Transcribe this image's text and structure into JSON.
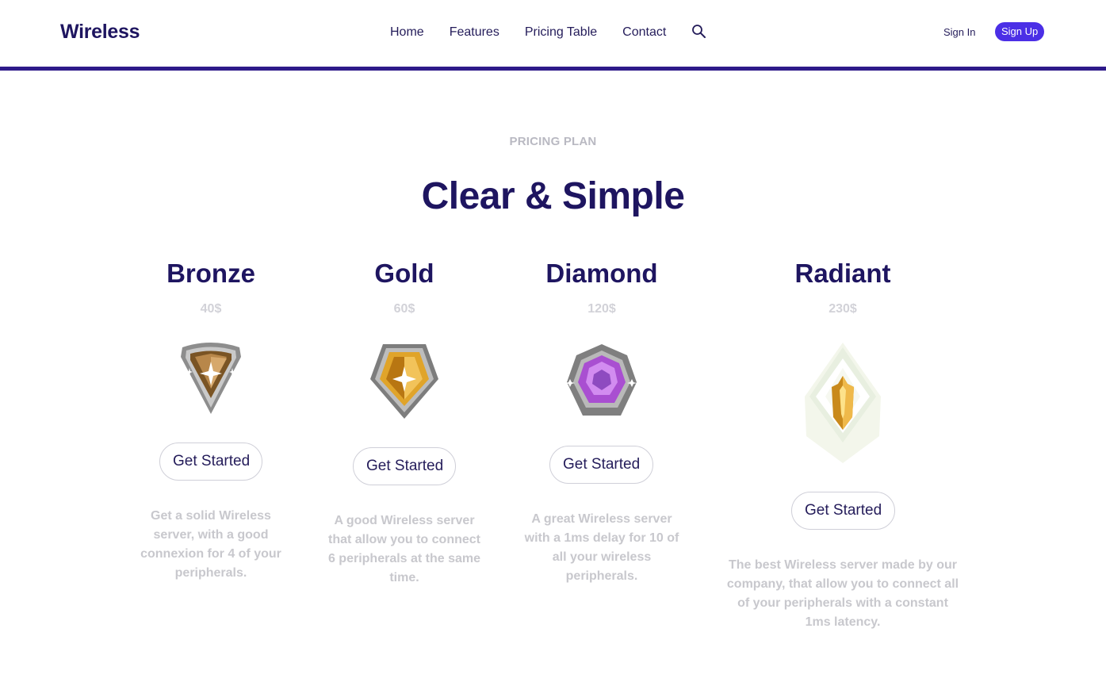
{
  "brand": {
    "name": "Wireless"
  },
  "nav": {
    "items": [
      "Home",
      "Features",
      "Pricing Table",
      "Contact"
    ],
    "search_icon": "search-icon"
  },
  "auth": {
    "signin_label": "Sign In",
    "signup_label": "Sign Up"
  },
  "colors": {
    "primary": "#1e1560",
    "accent": "#4b2fe6",
    "header_bar": "#2e1a8a"
  },
  "pricing": {
    "eyebrow": "PRICING PLAN",
    "headline": "Clear & Simple",
    "plans": [
      {
        "name": "Bronze",
        "price": "40$",
        "icon": "bronze-rank-icon",
        "cta": "Get Started",
        "description": "Get a solid Wireless server, with a good connexion for 4 of your peripherals."
      },
      {
        "name": "Gold",
        "price": "60$",
        "icon": "gold-rank-icon",
        "cta": "Get Started",
        "description": "A good Wireless server that allow you to connect 6 peripherals at the same time."
      },
      {
        "name": "Diamond",
        "price": "120$",
        "icon": "diamond-rank-icon",
        "cta": "Get Started",
        "description": "A great Wireless server with a 1ms delay for 10 of all your wireless peripherals."
      },
      {
        "name": "Radiant",
        "price": "230$",
        "icon": "radiant-rank-icon",
        "cta": "Get Started",
        "description": "The best Wireless server made by our company, that allow you to connect all of your peripherals with a constant 1ms latency."
      }
    ]
  }
}
